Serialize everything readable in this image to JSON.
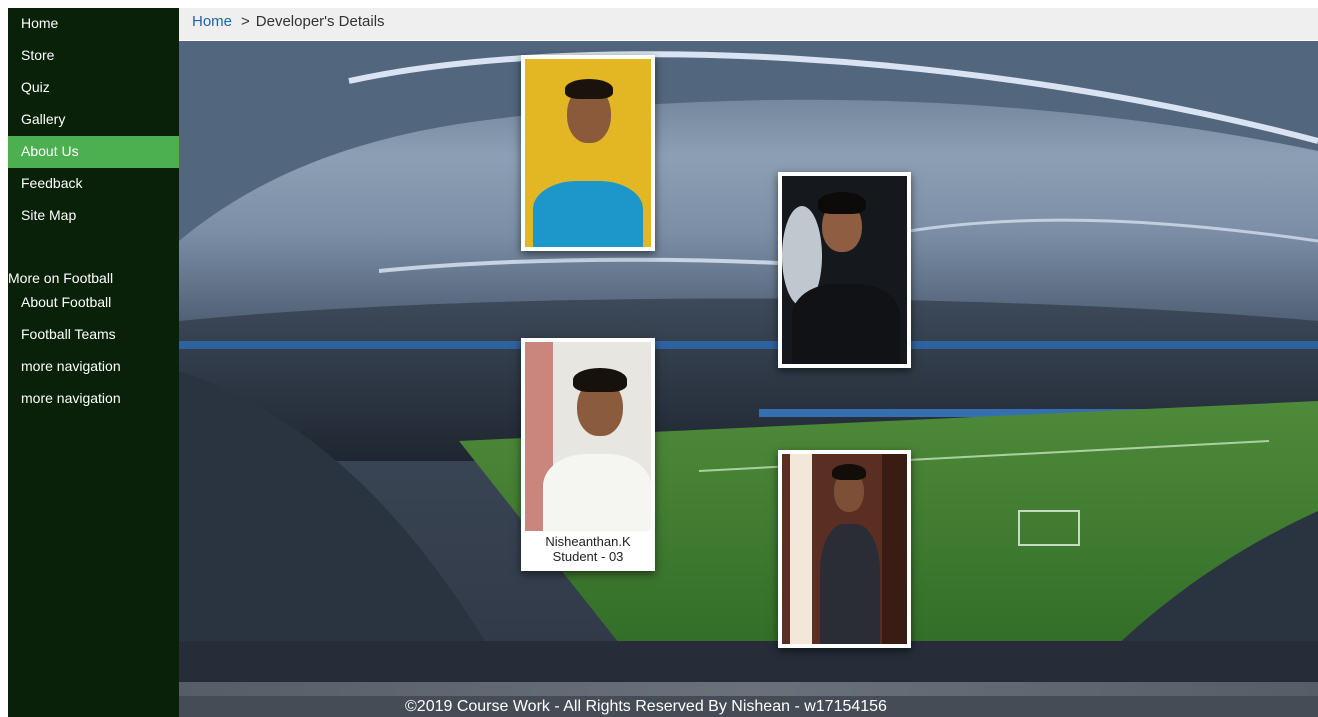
{
  "sidebar": {
    "items": [
      {
        "label": "Home"
      },
      {
        "label": "Store"
      },
      {
        "label": "Quiz"
      },
      {
        "label": "Gallery"
      },
      {
        "label": "About Us",
        "active": true
      },
      {
        "label": "Feedback"
      },
      {
        "label": "Site Map"
      }
    ],
    "group_title": "More on Football",
    "sub_items": [
      {
        "label": "About Football"
      },
      {
        "label": "Football Teams"
      },
      {
        "label": "more navigation"
      },
      {
        "label": "more navigation"
      }
    ]
  },
  "breadcrumb": {
    "home": "Home",
    "separator": ">",
    "current": "Developer's Details"
  },
  "developers": [
    {
      "name": "",
      "role": "",
      "photo_bg": "#e3b723"
    },
    {
      "name": "",
      "role": "",
      "photo_bg": "#15181d"
    },
    {
      "name": "Nisheanthan.K",
      "role": "Student - 03",
      "photo_bg": "#e8e6e0"
    },
    {
      "name": "",
      "role": "",
      "photo_bg": "#5a2e22"
    }
  ],
  "footer": {
    "text": "©2019 Course Work - All Rights Reserved By Nishean - w17154156"
  },
  "colors": {
    "sidebar_bg": "#082108",
    "active_item": "#4caf50",
    "breadcrumb_link": "#1e62b0"
  }
}
